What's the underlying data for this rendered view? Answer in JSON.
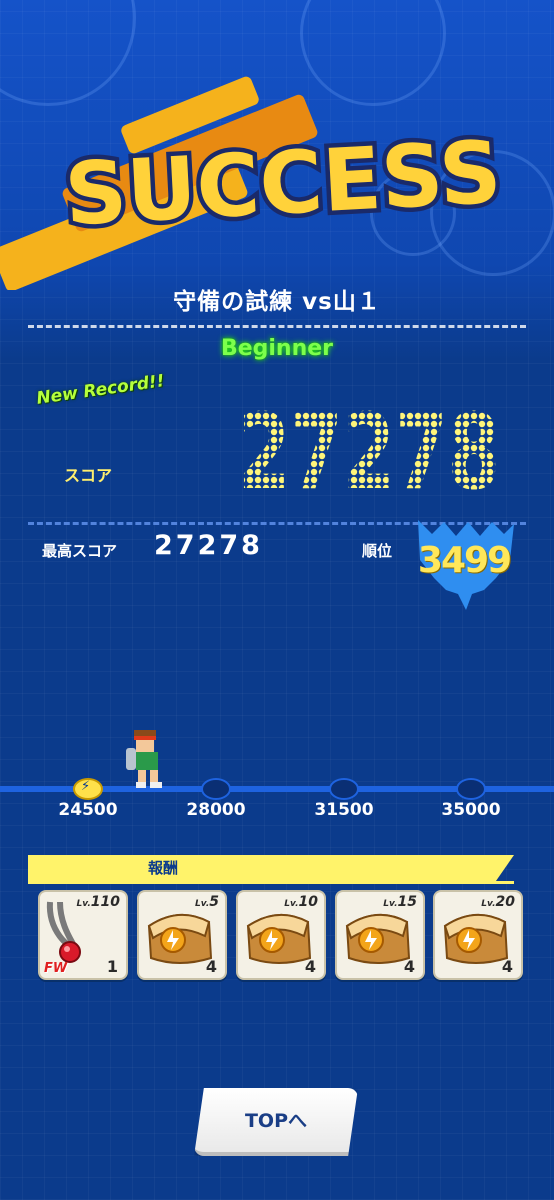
{
  "banner": {
    "title": "SUCCESS"
  },
  "stage": {
    "title": "守備の試練 vs山１",
    "difficulty": "Beginner"
  },
  "result": {
    "new_record": "New Record!!",
    "score_label": "スコア",
    "score": "27278",
    "best_label": "最高スコア",
    "best_value": "27278",
    "rank_label": "順位",
    "rank_value": "3499"
  },
  "progress": {
    "milestones": [
      "24500",
      "28000",
      "31500",
      "35000"
    ],
    "current_score": 27278
  },
  "rewards": {
    "header": "報酬",
    "items": [
      {
        "lv_prefix": "Lv.",
        "lv": "110",
        "count": "1",
        "tag": "FW",
        "icon": "red-pendant-icon"
      },
      {
        "lv_prefix": "Lv.",
        "lv": "5",
        "count": "4",
        "icon": "treasure-chest-icon"
      },
      {
        "lv_prefix": "Lv.",
        "lv": "10",
        "count": "4",
        "icon": "treasure-chest-icon"
      },
      {
        "lv_prefix": "Lv.",
        "lv": "15",
        "count": "4",
        "icon": "treasure-chest-icon"
      },
      {
        "lv_prefix": "Lv.",
        "lv": "20",
        "count": "4",
        "icon": "treasure-chest-icon"
      }
    ]
  },
  "buttons": {
    "top": "TOPへ"
  },
  "colors": {
    "accent_yellow": "#ffe14a",
    "success_orange": "#f5b21c",
    "difficulty_green": "#7cff4c",
    "background_blue": "#0b3b8c"
  }
}
